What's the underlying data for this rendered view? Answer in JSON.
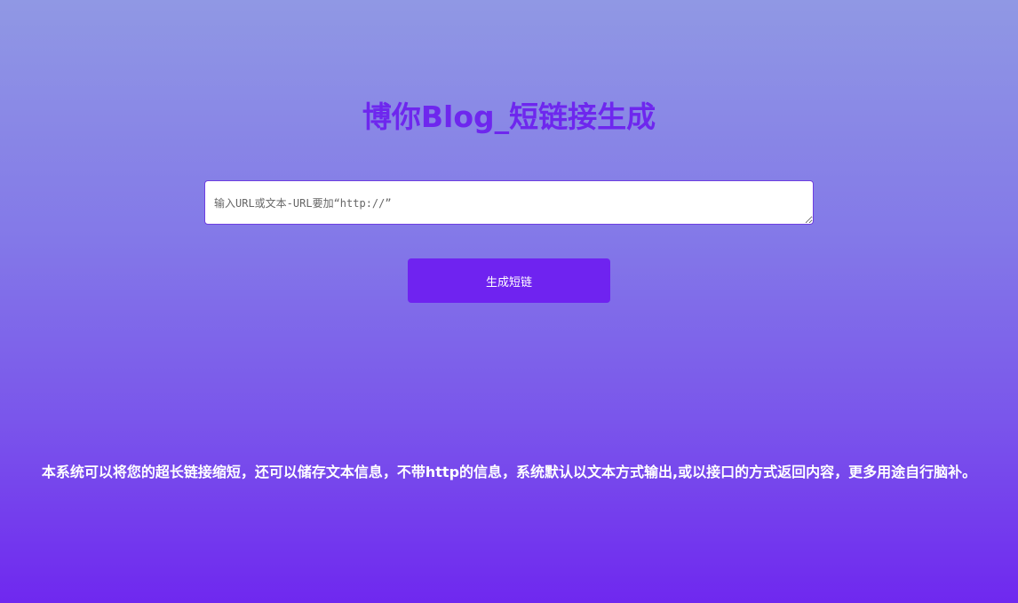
{
  "header": {
    "title": "博你Blog_短链接生成"
  },
  "form": {
    "url_input_placeholder": "输入URL或文本-URL要加“http://”",
    "url_input_value": "",
    "generate_button_label": "生成短链"
  },
  "footer": {
    "description": "本系统可以将您的超长链接缩短，还可以储存文本信息，不带http的信息，系统默认以文本方式输出,或以接口的方式返回内容，更多用途自行脑补。"
  },
  "colors": {
    "accent": "#6f23f0",
    "title": "#6e27ee",
    "background_top": "#9098e4",
    "background_bottom": "#6f28ef"
  }
}
